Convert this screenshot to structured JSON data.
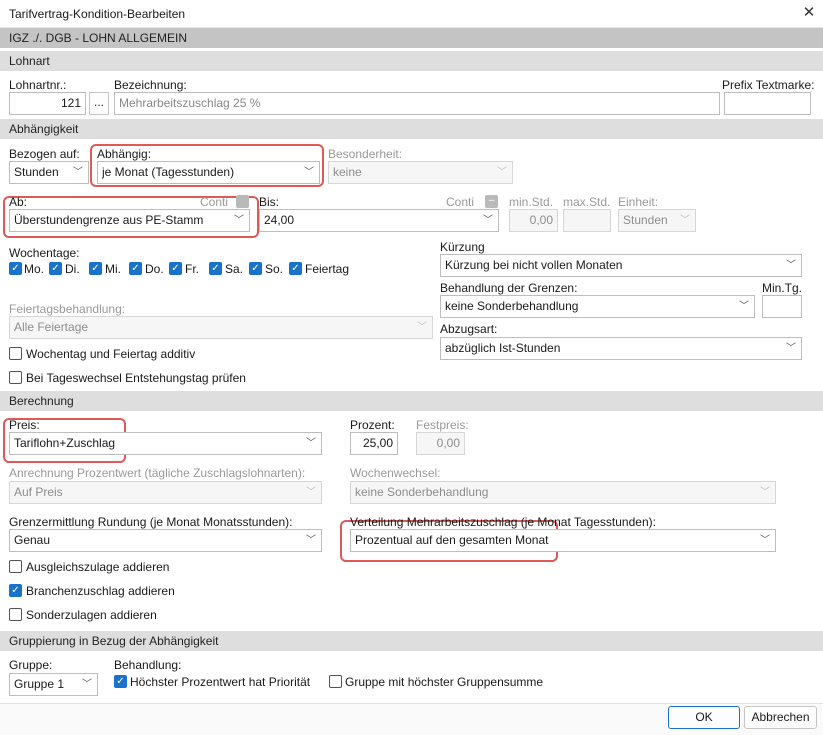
{
  "window": {
    "title": "Tarifvertrag-Kondition-Bearbeiten"
  },
  "header": "IGZ ./. DGB - LOHN ALLGEMEIN",
  "sections": {
    "lohnart": "Lohnart",
    "abhaengigkeit": "Abhängigkeit",
    "berechnung": "Berechnung",
    "gruppierung": "Gruppierung in Bezug der Abhängigkeit"
  },
  "lohnart": {
    "nr_label": "Lohnartnr.:",
    "nr_value": "121",
    "browse_label": "...",
    "bez_label": "Bezeichnung:",
    "bez_value": "Mehrarbeitszuschlag 25 %",
    "prefix_label": "Prefix Textmarke:",
    "prefix_value": ""
  },
  "abh": {
    "bezogen_label": "Bezogen auf:",
    "bezogen_value": "Stunden",
    "abhaengig_label": "Abhängig:",
    "abhaengig_value": "je Monat (Tagesstunden)",
    "besonderheit_label": "Besonderheit:",
    "besonderheit_value": "keine",
    "ab_label": "Ab:",
    "conti1_label": "Conti",
    "ab_value": "Überstundengrenze aus PE-Stamm",
    "bis_label": "Bis:",
    "conti2_label": "Conti",
    "bis_value": "24,00",
    "minstd_label": "min.Std.",
    "minstd_value": "0,00",
    "maxstd_label": "max.Std.",
    "maxstd_value": "",
    "einheit_label": "Einheit:",
    "einheit_value": "Stunden",
    "wochentage_label": "Wochentage:",
    "days": [
      "Mo.",
      "Di.",
      "Mi.",
      "Do.",
      "Fr.",
      "Sa.",
      "So.",
      "Feiertag"
    ],
    "kuerzung_label": "Kürzung",
    "kuerzung_value": "Kürzung bei nicht vollen Monaten",
    "grenzen_label": "Behandlung der Grenzen:",
    "grenzen_value": "keine Sonderbehandlung",
    "mintg_label": "Min.Tg.",
    "mintg_value": "",
    "feiertag_label": "Feiertagsbehandlung:",
    "feiertag_value": "Alle Feiertage",
    "abzug_label": "Abzugsart:",
    "abzug_value": "abzüglich Ist-Stunden",
    "additiv_label": "Wochentag und Feiertag additiv",
    "tageswechsel_label": "Bei Tageswechsel Entstehungstag prüfen"
  },
  "ber": {
    "preis_label": "Preis:",
    "preis_value": "Tariflohn+Zuschlag",
    "prozent_label": "Prozent:",
    "prozent_value": "25,00",
    "festpreis_label": "Festpreis:",
    "festpreis_value": "0,00",
    "anrechnung_label": "Anrechnung Prozentwert (tägliche Zuschlagslohnarten):",
    "anrechnung_value": "Auf Preis",
    "wochenwechsel_label": "Wochenwechsel:",
    "wochenwechsel_value": "keine Sonderbehandlung",
    "grenzermittlung_label": "Grenzermittlung Rundung (je Monat Monatsstunden):",
    "grenzermittlung_value": "Genau",
    "verteilung_label": "Verteilung Mehrarbeitszuschlag (je Monat Tagesstunden):",
    "verteilung_value": "Prozentual auf den gesamten Monat",
    "ausgleich_label": "Ausgleichszulage addieren",
    "branchen_label": "Branchenzuschlag addieren",
    "sonder_label": "Sonderzulagen addieren"
  },
  "grp": {
    "gruppe_label": "Gruppe:",
    "gruppe_value": "Gruppe 1",
    "behandlung_label": "Behandlung:",
    "prioritaet_label": "Höchster Prozentwert hat Priorität",
    "summe_label": "Gruppe mit höchster Gruppensumme"
  },
  "buttons": {
    "ok": "OK",
    "cancel": "Abbrechen"
  },
  "icons": {
    "close": "close-icon",
    "dropdown": "chevron-down-icon",
    "check": "checkmark-icon"
  },
  "colors": {
    "highlight": "#e05858",
    "checkbox": "#1a73c8"
  }
}
